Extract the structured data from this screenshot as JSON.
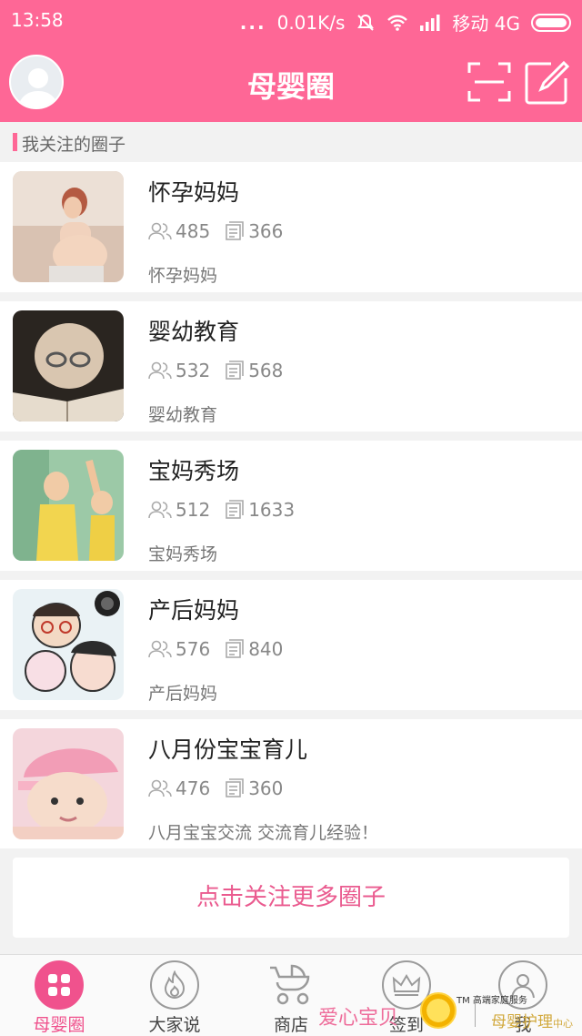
{
  "status_bar": {
    "time": "13:58",
    "dots": "...",
    "speed": "0.01K/s",
    "carrier": "移动 4G"
  },
  "header": {
    "title": "母婴圈"
  },
  "section": {
    "label": "我关注的圈子"
  },
  "circles": [
    {
      "name": "怀孕妈妈",
      "members": "485",
      "posts": "366",
      "desc": "怀孕妈妈",
      "thumb": "pregnant-photo"
    },
    {
      "name": "婴幼教育",
      "members": "532",
      "posts": "568",
      "desc": "婴幼教育",
      "thumb": "baby-reading-photo"
    },
    {
      "name": "宝妈秀场",
      "members": "512",
      "posts": "1633",
      "desc": "宝妈秀场",
      "thumb": "mom-dance-photo"
    },
    {
      "name": "产后妈妈",
      "members": "576",
      "posts": "840",
      "desc": "产后妈妈",
      "thumb": "cartoon-family-photo"
    },
    {
      "name": "八月份宝宝育儿",
      "members": "476",
      "posts": "360",
      "desc": "八月宝宝交流 交流育儿经验！",
      "thumb": "baby-pink-hat-photo"
    }
  ],
  "more_button": "点击关注更多圈子",
  "tabs": [
    {
      "label": "母婴圈",
      "icon": "grid-icon",
      "active": true
    },
    {
      "label": "大家说",
      "icon": "flame-icon",
      "active": false
    },
    {
      "label": "商店",
      "icon": "stroller-icon",
      "active": false
    },
    {
      "label": "签到",
      "icon": "crown-icon",
      "active": false
    },
    {
      "label": "我",
      "icon": "user-icon",
      "active": false
    }
  ],
  "watermark": {
    "left": "爱心宝贝",
    "tm": "TM 高端家庭服务",
    "right": "母婴护理",
    "right_small": "中心"
  },
  "colors": {
    "brand_pink": "#fe6796",
    "accent_pink": "#f0528d"
  }
}
